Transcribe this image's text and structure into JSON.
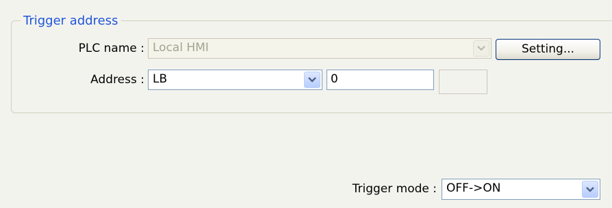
{
  "group": {
    "title": "Trigger address"
  },
  "plc": {
    "label": "PLC name :",
    "value": "Local HMI",
    "setting_button": "Setting..."
  },
  "address": {
    "label": "Address :",
    "device_type": "LB",
    "address_value": "0",
    "extra_value": ""
  },
  "trigger": {
    "label": "Trigger mode :",
    "value": "OFF->ON"
  }
}
